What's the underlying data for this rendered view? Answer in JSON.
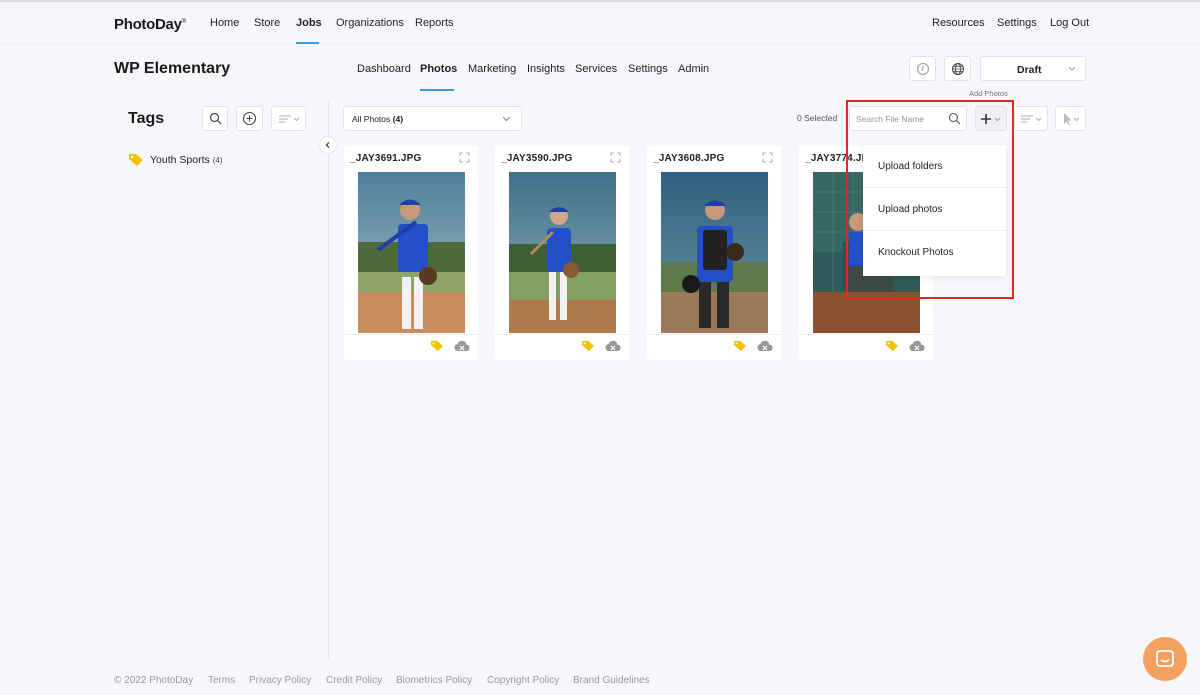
{
  "topnav": {
    "brand": "PhotoDay",
    "left_links": [
      {
        "label": "Home"
      },
      {
        "label": "Store"
      },
      {
        "label": "Jobs"
      },
      {
        "label": "Organizations"
      },
      {
        "label": "Reports"
      }
    ],
    "right_links": [
      {
        "label": "Resources"
      },
      {
        "label": "Settings"
      },
      {
        "label": "Log Out"
      }
    ],
    "active": "Jobs"
  },
  "job": {
    "title": "WP Elementary",
    "tabs": [
      {
        "label": "Dashboard"
      },
      {
        "label": "Photos"
      },
      {
        "label": "Marketing"
      },
      {
        "label": "Insights"
      },
      {
        "label": "Services"
      },
      {
        "label": "Settings"
      },
      {
        "label": "Admin"
      }
    ],
    "active_tab": "Photos",
    "status": "Draft",
    "add_photos_label": "Add Photos"
  },
  "sidebar": {
    "title": "Tags",
    "tags": [
      {
        "name": "Youth Sports",
        "count": "(4)"
      }
    ]
  },
  "toolbar": {
    "filter_label": "All Photos",
    "filter_count": "(4)",
    "selected": "0 Selected",
    "search_placeholder": "Search File Name",
    "search_value": ""
  },
  "photos": [
    {
      "filename": "_JAY3691.JPG",
      "bg": "#7c9aa8",
      "ground": "#c98c5e"
    },
    {
      "filename": "_JAY3590.JPG",
      "bg": "#5e8aa0",
      "ground": "#b07b4c"
    },
    {
      "filename": "_JAY3608.JPG",
      "bg": "#3d6e88",
      "ground": "#9a7a5a"
    },
    {
      "filename": "_JAY3774.JPG",
      "bg": "#2f5a5a",
      "ground": "#8a5030"
    }
  ],
  "dropdown": {
    "items": [
      {
        "label": "Upload folders"
      },
      {
        "label": "Upload photos"
      },
      {
        "label": "Knockout Photos"
      }
    ]
  },
  "footer": {
    "copyright": "© 2022 PhotoDay",
    "links": [
      {
        "label": "Terms"
      },
      {
        "label": "Privacy Policy"
      },
      {
        "label": "Credit Policy"
      },
      {
        "label": "Biometrics Policy"
      },
      {
        "label": "Copyright Policy"
      },
      {
        "label": "Brand Guidelines"
      }
    ]
  },
  "colors": {
    "accent": "#3a9be0",
    "highlight": "#e02a20",
    "tag": "#f2c200",
    "chat": "#f4a061"
  },
  "icons": {
    "search": "search-icon",
    "add": "plus-icon",
    "sort": "sort-icon",
    "history": "clock-icon",
    "globe": "globe-icon",
    "cursor": "cursor-icon",
    "tag": "tag-icon",
    "download": "cloud-download-icon",
    "expand": "expand-icon",
    "chat": "chat-icon"
  }
}
